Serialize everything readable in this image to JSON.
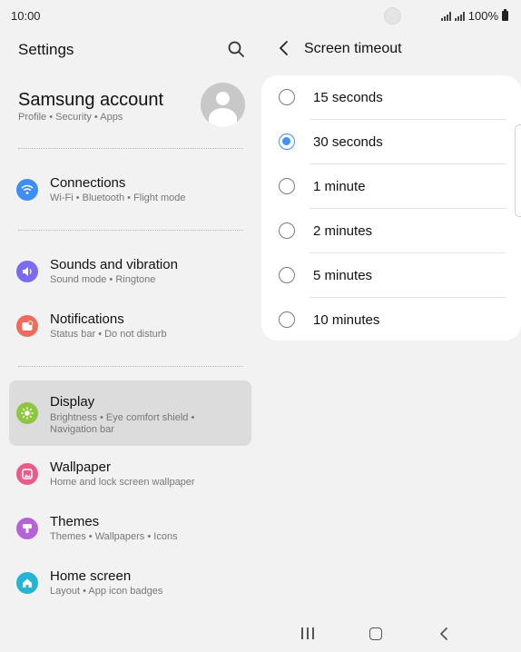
{
  "status_bar": {
    "time": "10:00",
    "battery": "100%"
  },
  "left_pane": {
    "title": "Settings",
    "account": {
      "name": "Samsung account",
      "subtitle": "Profile  •  Security  •  Apps"
    },
    "items": [
      {
        "label": "Connections",
        "sub": "Wi-Fi  •  Bluetooth  •  Flight mode",
        "icon": "wifi-icon",
        "color": "#3e8ef7"
      },
      {
        "label": "Sounds and vibration",
        "sub": "Sound mode  •  Ringtone",
        "icon": "volume-icon",
        "color": "#7a6cf0"
      },
      {
        "label": "Notifications",
        "sub": "Status bar  •  Do not disturb",
        "icon": "notification-icon",
        "color": "#f06a5e"
      },
      {
        "label": "Display",
        "sub": "Brightness  •  Eye comfort shield  •  Navigation bar",
        "icon": "sun-icon",
        "color": "#8fc63f",
        "selected": true
      },
      {
        "label": "Wallpaper",
        "sub": "Home and lock screen wallpaper",
        "icon": "image-icon",
        "color": "#e75c8a"
      },
      {
        "label": "Themes",
        "sub": "Themes  •  Wallpapers  •  Icons",
        "icon": "brush-icon",
        "color": "#b464d6"
      },
      {
        "label": "Home screen",
        "sub": "Layout  •  App icon badges",
        "icon": "home-icon",
        "color": "#25b4d3"
      }
    ]
  },
  "right_pane": {
    "title": "Screen timeout",
    "options": [
      {
        "label": "15 seconds",
        "checked": false
      },
      {
        "label": "30 seconds",
        "checked": true
      },
      {
        "label": "1 minute",
        "checked": false
      },
      {
        "label": "2 minutes",
        "checked": false
      },
      {
        "label": "5 minutes",
        "checked": false
      },
      {
        "label": "10 minutes",
        "checked": false
      }
    ]
  },
  "colors": {
    "accent": "#3e91ff",
    "background": "#f2f2f2",
    "card": "#ffffff",
    "selected_row": "#dcdcdc"
  }
}
